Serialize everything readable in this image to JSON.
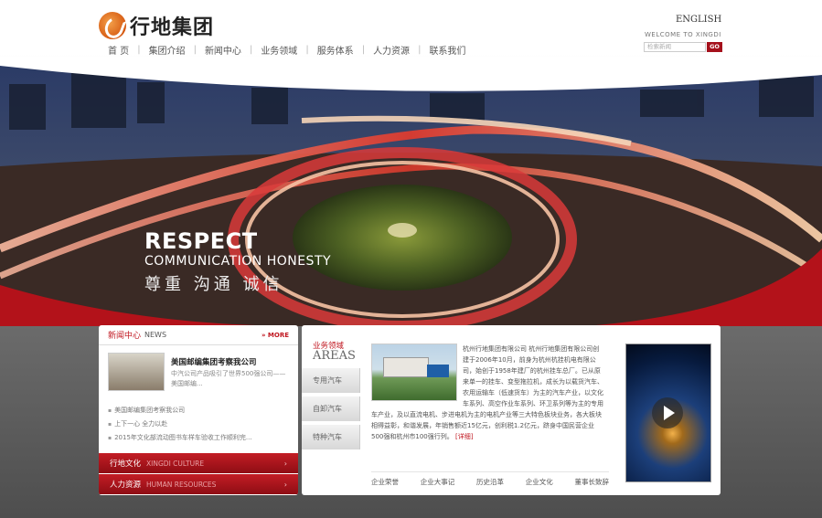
{
  "header": {
    "logo_text": "行地集团",
    "english_link": "ENGLISH",
    "welcome": "WELCOME TO XINGDI",
    "search_placeholder": "检索新闻",
    "search_button": "GO"
  },
  "nav": {
    "items": [
      "首 页",
      "集团介绍",
      "新闻中心",
      "业务领域",
      "服务体系",
      "人力资源",
      "联系我们"
    ]
  },
  "banner": {
    "slogan_en_1": "RESPECT",
    "slogan_en_2": "COMMUNICATION  HONESTY",
    "slogan_cn": "尊重 沟通 诚信"
  },
  "news": {
    "title_cn": "新闻中心",
    "title_en": "NEWS",
    "more": "MORE",
    "featured_title": "美国邮编集团考察我公司",
    "featured_desc": "中汽公司产品吸引了世界500强公司——美国邮编...",
    "items": [
      "美国邮编集团考察我公司",
      "上下一心 全力以赴",
      "2015年文化部流动图书车样车验收工作顺利完..."
    ]
  },
  "culture_bar": {
    "cn": "行地文化",
    "en": "XINGDI CULTURE",
    "arrow": "›"
  },
  "hr_bar": {
    "cn": "人力资源",
    "en": "HUMAN RESOURCES",
    "arrow": "›"
  },
  "business": {
    "title_cn": "业务领域",
    "title_en": "AREAS",
    "tabs": [
      "专用汽车",
      "自卸汽车",
      "特种汽车"
    ],
    "text": "杭州行地集团有限公司 杭州行地集团有限公司创建于2006年10月，前身为杭州杭挂机电有限公司，始创于1958年建厂的杭州挂车总厂。已从原来单一的挂车、变型拖拉机，成长为以载货汽车、农用运输车（低速货车）为主的汽车产业，以文化车系列、高空作业车系列、环卫系列等为主的专用车产业，及以直流电机、步进电机为主的电机产业等三大特色板块业务，各大板块相得益彰，和谐发展，年销售额近15亿元，创利税1.2亿元，跻身中国民营企业500强和杭州市100强行列。",
    "detail": "[详细]",
    "links": [
      "企业荣誉",
      "企业大事记",
      "历史沿革",
      "企业文化",
      "董事长致辞"
    ]
  }
}
